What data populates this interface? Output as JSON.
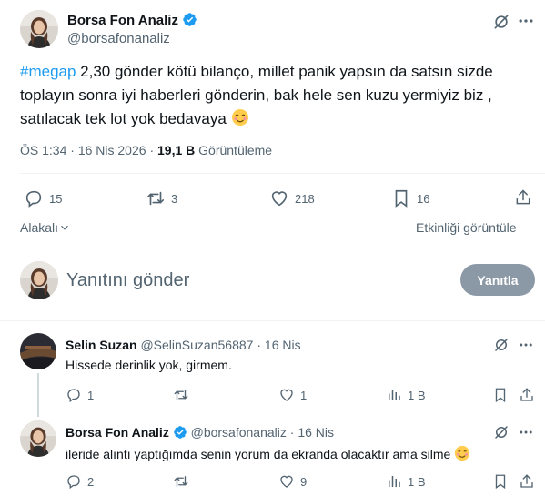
{
  "main_tweet": {
    "author_name": "Borsa Fon Analiz",
    "author_handle": "@borsafonanaliz",
    "hashtag": "#megap",
    "text_line1": " 2,30 gönder kötü bilanço, millet panik yapsın da satsın sizde",
    "text_line2": "toplayın sonra iyi haberleri gönderin, bak hele sen kuzu yermiyiz biz ,",
    "text_line3": "satılacak tek lot yok  bedavaya",
    "time": "ÖS 1:34",
    "date": "16 Nis 2026",
    "views_count": "19,1 B",
    "views_label": "Görüntüleme",
    "replies": "15",
    "reposts": "3",
    "likes": "218",
    "bookmarks": "16"
  },
  "relevance": {
    "sort_label": "Alakalı",
    "activity_label": "Etkinliği görüntüle"
  },
  "reply_box": {
    "placeholder": "Yanıtını gönder",
    "button": "Yanıtla"
  },
  "replies": [
    {
      "author_name": "Selin Suzan",
      "author_handle": "@SelinSuzan56887",
      "date": "16 Nis",
      "text": "Hissede derinlik yok, girmem.",
      "replies": "1",
      "reposts": "",
      "likes": "1",
      "views": "1 B"
    },
    {
      "author_name": "Borsa Fon Analiz",
      "author_handle": "@borsafonanaliz",
      "date": "16 Nis",
      "text": "ileride alıntı yaptığımda senin yorum da ekranda olacaktır ama silme",
      "replies": "2",
      "reposts": "",
      "likes": "9",
      "views": "1 B"
    }
  ],
  "colors": {
    "accent": "#1d9bf0",
    "muted": "#536471",
    "border": "#eff3f4",
    "button_disabled": "#8b98a5"
  },
  "icons": [
    "grok-icon",
    "more-icon",
    "reply-icon",
    "repost-icon",
    "like-icon",
    "bookmark-icon",
    "share-icon",
    "views-icon",
    "chevron-down-icon",
    "verified-icon"
  ]
}
